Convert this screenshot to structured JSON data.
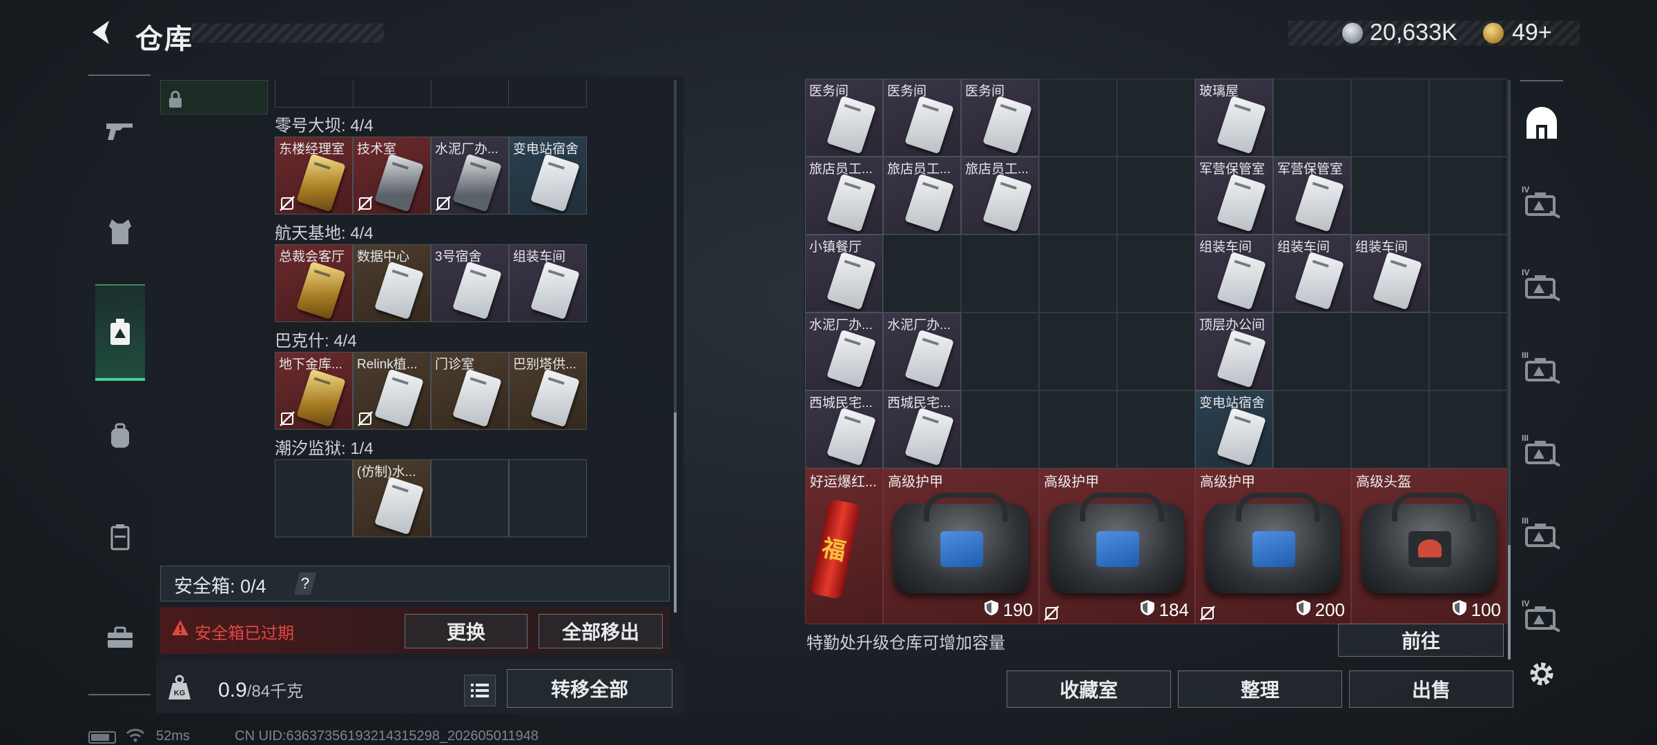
{
  "header": {
    "title": "仓库",
    "currency_silver": "20,633K",
    "currency_gold": "49+"
  },
  "left_panel": {
    "maps": [
      {
        "label": "零号大坝: 4/4",
        "cards": [
          {
            "name": "东楼经理室",
            "color": "red",
            "style": "gold",
            "no_trade": true
          },
          {
            "name": "技术室",
            "color": "red",
            "style": "dark",
            "no_trade": true
          },
          {
            "name": "水泥厂办...",
            "color": "purple",
            "style": "dark",
            "no_trade": true
          },
          {
            "name": "变电站宿舍",
            "color": "blue",
            "style": "silver",
            "no_trade": false
          }
        ]
      },
      {
        "label": "航天基地: 4/4",
        "cards": [
          {
            "name": "总裁会客厅",
            "color": "red",
            "style": "gold",
            "no_trade": false
          },
          {
            "name": "数据中心",
            "color": "brown",
            "style": "silver",
            "no_trade": false
          },
          {
            "name": "3号宿舍",
            "color": "purple",
            "style": "silver",
            "no_trade": false
          },
          {
            "name": "组装车间",
            "color": "purple",
            "style": "silver",
            "no_trade": false
          }
        ]
      },
      {
        "label": "巴克什: 4/4",
        "cards": [
          {
            "name": "地下金库...",
            "color": "red",
            "style": "gold",
            "no_trade": true
          },
          {
            "name": "Relink植...",
            "color": "brown",
            "style": "silver",
            "no_trade": true
          },
          {
            "name": "门诊室",
            "color": "brown",
            "style": "silver",
            "no_trade": false
          },
          {
            "name": "巴别塔供...",
            "color": "brown",
            "style": "silver",
            "no_trade": false
          }
        ]
      },
      {
        "label": "潮汐监狱: 1/4",
        "cards": [
          {
            "name": "",
            "color": "empty",
            "style": "",
            "no_trade": false
          },
          {
            "name": "(仿制)水...",
            "color": "brown",
            "style": "silver",
            "no_trade": false
          },
          {
            "name": "",
            "color": "empty",
            "style": "",
            "no_trade": false
          },
          {
            "name": "",
            "color": "empty",
            "style": "",
            "no_trade": false
          }
        ]
      }
    ],
    "safe_box_label": "安全箱: 0/4",
    "help": "?",
    "expired_text": "安全箱已过期",
    "replace_btn": "更换",
    "remove_all_btn": "全部移出",
    "weight_value": "0.9",
    "weight_cap": "/84千克",
    "transfer_all_btn": "转移全部"
  },
  "grid": {
    "small_items": [
      {
        "name": "医务间",
        "col": 0,
        "row": 0,
        "color": "purple"
      },
      {
        "name": "医务间",
        "col": 1,
        "row": 0,
        "color": "purple"
      },
      {
        "name": "医务间",
        "col": 2,
        "row": 0,
        "color": "purple"
      },
      {
        "name": "玻璃屋",
        "col": 5,
        "row": 0,
        "color": "purple"
      },
      {
        "name": "旅店员工...",
        "col": 0,
        "row": 1,
        "color": "purple"
      },
      {
        "name": "旅店员工...",
        "col": 1,
        "row": 1,
        "color": "purple"
      },
      {
        "name": "旅店员工...",
        "col": 2,
        "row": 1,
        "color": "purple"
      },
      {
        "name": "军营保管室",
        "col": 5,
        "row": 1,
        "color": "purple"
      },
      {
        "name": "军营保管室",
        "col": 6,
        "row": 1,
        "color": "purple"
      },
      {
        "name": "小镇餐厅",
        "col": 0,
        "row": 2,
        "color": "purple"
      },
      {
        "name": "组装车间",
        "col": 5,
        "row": 2,
        "color": "purple"
      },
      {
        "name": "组装车间",
        "col": 6,
        "row": 2,
        "color": "purple"
      },
      {
        "name": "组装车间",
        "col": 7,
        "row": 2,
        "color": "purple"
      },
      {
        "name": "水泥厂办...",
        "col": 0,
        "row": 3,
        "color": "purple"
      },
      {
        "name": "水泥厂办...",
        "col": 1,
        "row": 3,
        "color": "purple"
      },
      {
        "name": "顶层办公间",
        "col": 5,
        "row": 3,
        "color": "purple"
      },
      {
        "name": "西城民宅...",
        "col": 0,
        "row": 4,
        "color": "purple"
      },
      {
        "name": "西城民宅...",
        "col": 1,
        "row": 4,
        "color": "purple"
      },
      {
        "name": "变电站宿舍",
        "col": 5,
        "row": 4,
        "color": "blue"
      }
    ],
    "big_items": [
      {
        "name": "好运爆红...",
        "type": "firecracker",
        "glyph": "福",
        "durability": "",
        "no_trade": false
      },
      {
        "name": "高级护甲",
        "type": "armor",
        "glyph": "",
        "durability": "190",
        "no_trade": false
      },
      {
        "name": "高级护甲",
        "type": "armor",
        "glyph": "",
        "durability": "184",
        "no_trade": true
      },
      {
        "name": "高级护甲",
        "type": "armor",
        "glyph": "",
        "durability": "200",
        "no_trade": true
      },
      {
        "name": "高级头盔",
        "type": "helmet",
        "glyph": "",
        "durability": "100",
        "no_trade": false
      }
    ],
    "upgrade_hint": "特勤处升级仓库可增加容量",
    "goto_btn": "前往"
  },
  "bottom_buttons": {
    "collection": "收藏室",
    "organize": "整理",
    "sell": "出售"
  },
  "right_nav": [
    {
      "label": "",
      "icon": "home-icon"
    },
    {
      "label": "IV",
      "icon": "tier4-case-icon"
    },
    {
      "label": "IV",
      "icon": "tier4-folder-icon"
    },
    {
      "label": "III",
      "icon": "tier3-warning-icon"
    },
    {
      "label": "III",
      "icon": "tier3-box-icon"
    },
    {
      "label": "III",
      "icon": "tier3-gun-icon"
    },
    {
      "label": "IV",
      "icon": "tier4-cash-icon"
    }
  ],
  "status": {
    "ping": "52ms",
    "uid": "CN UID:6363735619321431529​8_202605011948"
  },
  "colors": {
    "accent_green": "#3fd98f",
    "warning_red": "#e0473f",
    "rare_red": "#6a2a2c",
    "epic_purple": "#3a3546"
  }
}
